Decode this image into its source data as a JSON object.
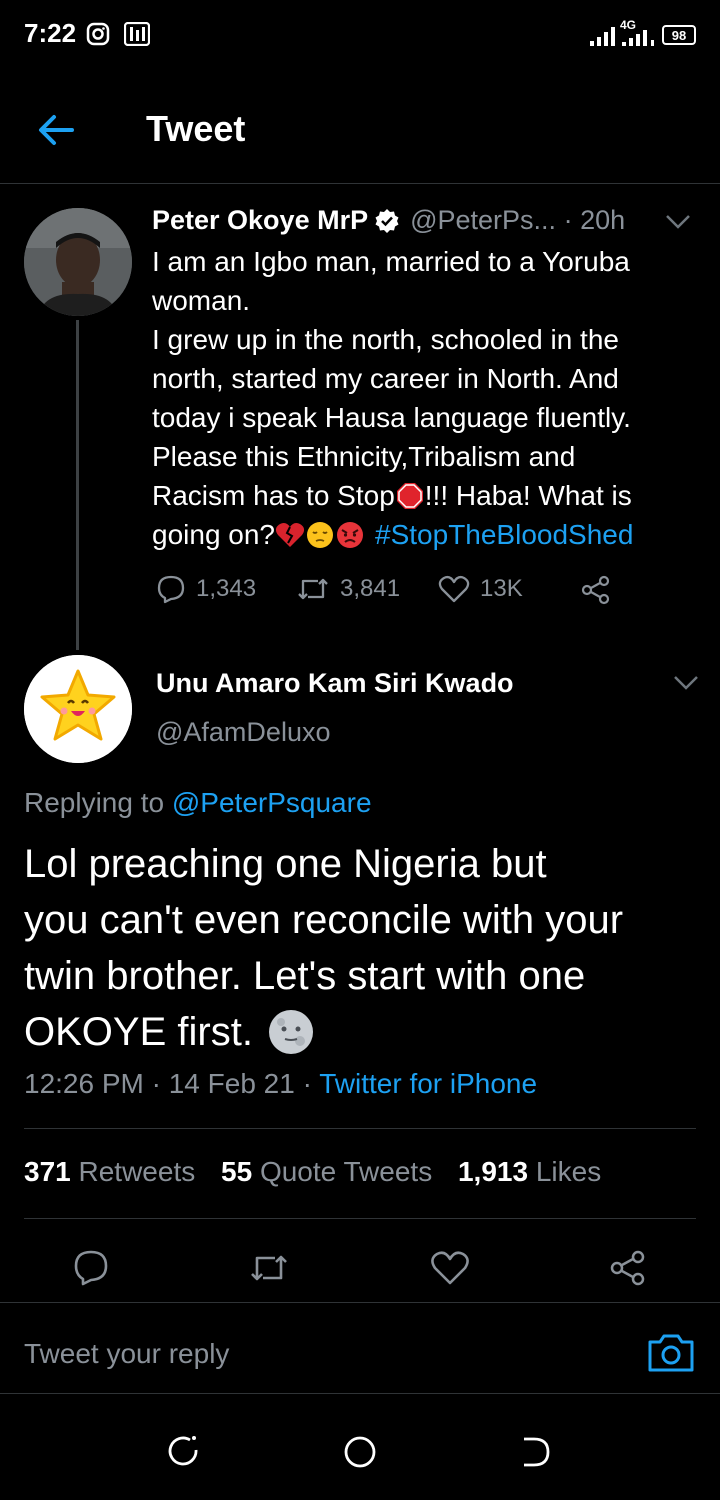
{
  "status_bar": {
    "time": "7:22",
    "network": "4G",
    "battery": "98"
  },
  "header": {
    "title": "Tweet"
  },
  "parent_tweet": {
    "name": "Peter Okoye MrP",
    "handle": "@PeterPs...",
    "separator": " · ",
    "time": "20h",
    "text_lines": [
      "I am an Igbo man, married to a Yoruba",
      "woman.",
      "I grew up in the north, schooled in the",
      "north, started my career in North. And",
      "today i speak Hausa language fluently.",
      "Please this Ethnicity,Tribalism and"
    ],
    "text_line7_a": "Racism has to Stop",
    "text_line7_b": "!!! Haba! What is",
    "text_line8_a": "going on?",
    "hashtag": "#StopTheBloodShed",
    "replies": "1,343",
    "retweets": "3,841",
    "likes": "13K"
  },
  "reply_tweet": {
    "name": "Unu Amaro Kam Siri Kwado",
    "handle": "@AfamDeluxo",
    "replying_prefix": "Replying to ",
    "replying_to": "@PeterPsquare",
    "text_lines": [
      "Lol preaching one Nigeria but",
      "you can't even reconcile with your",
      "twin brother. Let's start with one",
      "OKOYE first."
    ],
    "timestamp": "12:26 PM · 14 Feb 21 · ",
    "source": "Twitter for iPhone"
  },
  "stats": {
    "retweets_count": "371",
    "retweets_label": "Retweets",
    "quotes_count": "55",
    "quotes_label": "Quote Tweets",
    "likes_count": "1,913",
    "likes_label": "Likes"
  },
  "reply_bar": {
    "placeholder": "Tweet your reply"
  },
  "colors": {
    "background": "#000000",
    "accent": "#1da1f2",
    "muted": "#8a9199"
  }
}
